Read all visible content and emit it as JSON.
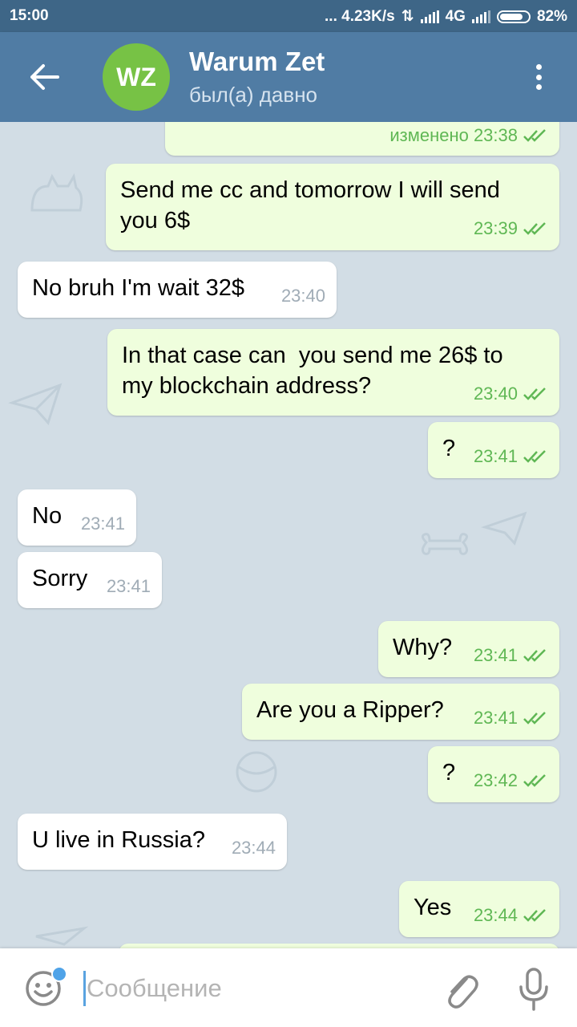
{
  "status_bar": {
    "time": "15:00",
    "network_speed": "... 4.23K/s",
    "network_type": "4G",
    "battery": "82%",
    "battery_level": 0.82
  },
  "header": {
    "back_icon": "arrow-left-icon",
    "avatar_initials": "WZ",
    "contact_name": "Warum Zet",
    "last_seen": "был(а) давно",
    "menu_icon": "more-vertical-icon",
    "header_color": "#507ca4",
    "avatar_color": "#77c245"
  },
  "messages": [
    {
      "text": "",
      "meta": "изменено 23:38",
      "outgoing": true
    },
    {
      "text": "Send me cc and tomorrow I will send\nyou 6$",
      "time": "23:39",
      "outgoing": true
    },
    {
      "text": "No bruh I'm wait 32$",
      "time": "23:40",
      "outgoing": false
    },
    {
      "text": "In that case can  you send me 26$ to\nmy blockchain address?",
      "time": "23:40",
      "outgoing": true
    },
    {
      "text": "?",
      "time": "23:41",
      "outgoing": true
    },
    {
      "text": "No",
      "time": "23:41",
      "outgoing": false
    },
    {
      "text": "Sorry",
      "time": "23:41",
      "outgoing": false
    },
    {
      "text": "Why?",
      "time": "23:41",
      "outgoing": true
    },
    {
      "text": "Are you a Ripper?",
      "time": "23:41",
      "outgoing": true
    },
    {
      "text": "?",
      "time": "23:42",
      "outgoing": true
    },
    {
      "text": "U live in Russia?",
      "time": "23:44",
      "outgoing": false
    },
    {
      "text": "Yes",
      "time": "23:44",
      "outgoing": true
    }
  ],
  "input": {
    "placeholder": "Сообщение",
    "emoji_icon": "smiley-icon",
    "attach_icon": "paperclip-icon",
    "mic_icon": "microphone-icon"
  },
  "colors": {
    "outgoing_bubble": "#effedd",
    "incoming_bubble": "#ffffff",
    "read_check": "#5fb754"
  }
}
